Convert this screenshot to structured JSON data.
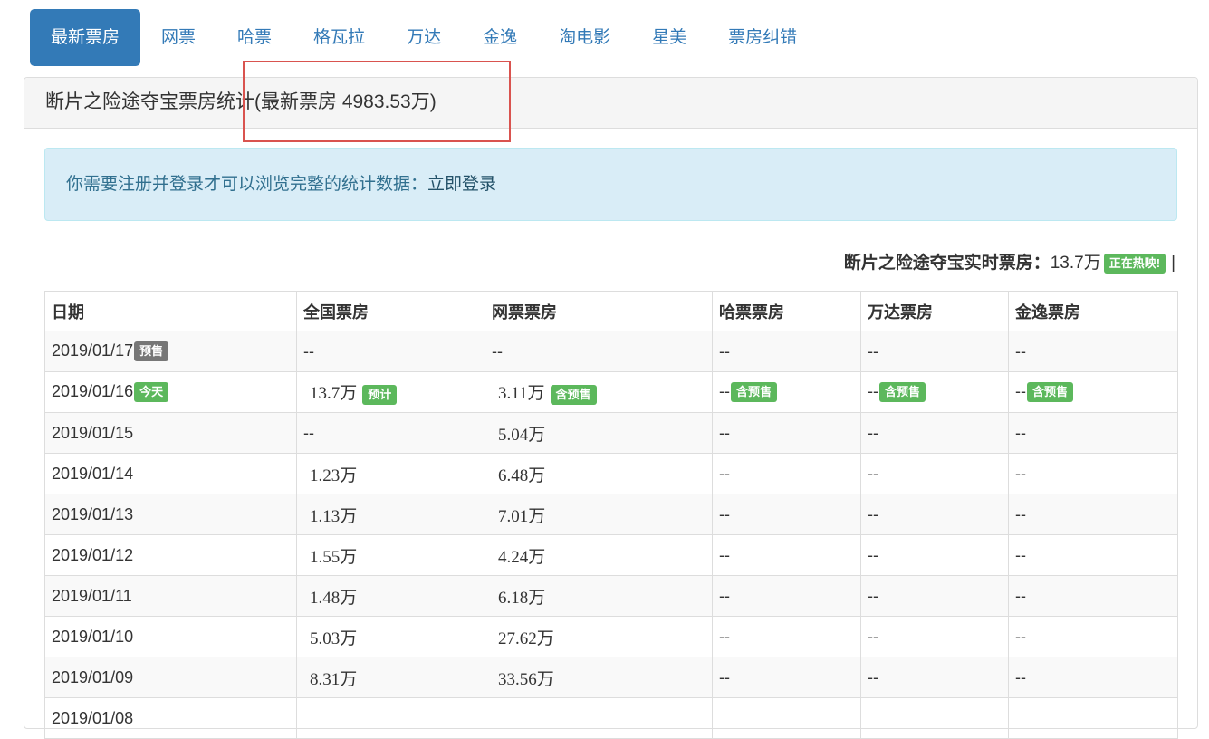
{
  "nav": {
    "tabs": [
      {
        "label": "最新票房",
        "active": true
      },
      {
        "label": "网票",
        "active": false
      },
      {
        "label": "哈票",
        "active": false
      },
      {
        "label": "格瓦拉",
        "active": false
      },
      {
        "label": "万达",
        "active": false
      },
      {
        "label": "金逸",
        "active": false
      },
      {
        "label": "淘电影",
        "active": false
      },
      {
        "label": "星美",
        "active": false
      },
      {
        "label": "票房纠错",
        "active": false
      }
    ]
  },
  "panel": {
    "title": "断片之险途夺宝票房统计(最新票房 4983.53万)"
  },
  "alert": {
    "text": "你需要注册并登录才可以浏览完整的统计数据：",
    "link": "立即登录"
  },
  "live": {
    "label": "断片之险途夺宝实时票房：",
    "value": "13.7万",
    "badge": "正在热映!",
    "separator": "|"
  },
  "table": {
    "headers": [
      "日期",
      "全国票房",
      "网票票房",
      "哈票票房",
      "万达票房",
      "金逸票房"
    ],
    "rows": [
      {
        "date": "2019/01/17",
        "date_badge": "预售",
        "date_badge_color": "#777777",
        "national": "--",
        "national_badge": "",
        "wangpiao": "--",
        "wangpiao_badge": "",
        "hapiao": "--",
        "hapiao_badge": "",
        "wanda": "--",
        "wanda_badge": "",
        "jinyi": "--",
        "jinyi_badge": ""
      },
      {
        "date": "2019/01/16",
        "date_badge": "今天",
        "date_badge_color": "#5cb85c",
        "national": "13.7万",
        "national_badge": "预计",
        "wangpiao": "3.11万",
        "wangpiao_badge": "含预售",
        "hapiao": "--",
        "hapiao_badge": "含预售",
        "wanda": "--",
        "wanda_badge": "含预售",
        "jinyi": "--",
        "jinyi_badge": "含预售"
      },
      {
        "date": "2019/01/15",
        "date_badge": "",
        "national": "--",
        "national_badge": "",
        "wangpiao": "5.04万",
        "wangpiao_badge": "",
        "hapiao": "--",
        "hapiao_badge": "",
        "wanda": "--",
        "wanda_badge": "",
        "jinyi": "--",
        "jinyi_badge": ""
      },
      {
        "date": "2019/01/14",
        "date_badge": "",
        "national": "1.23万",
        "national_badge": "",
        "wangpiao": "6.48万",
        "wangpiao_badge": "",
        "hapiao": "--",
        "hapiao_badge": "",
        "wanda": "--",
        "wanda_badge": "",
        "jinyi": "--",
        "jinyi_badge": ""
      },
      {
        "date": "2019/01/13",
        "date_badge": "",
        "national": "1.13万",
        "national_badge": "",
        "wangpiao": "7.01万",
        "wangpiao_badge": "",
        "hapiao": "--",
        "hapiao_badge": "",
        "wanda": "--",
        "wanda_badge": "",
        "jinyi": "--",
        "jinyi_badge": ""
      },
      {
        "date": "2019/01/12",
        "date_badge": "",
        "national": "1.55万",
        "national_badge": "",
        "wangpiao": "4.24万",
        "wangpiao_badge": "",
        "hapiao": "--",
        "hapiao_badge": "",
        "wanda": "--",
        "wanda_badge": "",
        "jinyi": "--",
        "jinyi_badge": ""
      },
      {
        "date": "2019/01/11",
        "date_badge": "",
        "national": "1.48万",
        "national_badge": "",
        "wangpiao": "6.18万",
        "wangpiao_badge": "",
        "hapiao": "--",
        "hapiao_badge": "",
        "wanda": "--",
        "wanda_badge": "",
        "jinyi": "--",
        "jinyi_badge": ""
      },
      {
        "date": "2019/01/10",
        "date_badge": "",
        "national": "5.03万",
        "national_badge": "",
        "wangpiao": "27.62万",
        "wangpiao_badge": "",
        "hapiao": "--",
        "hapiao_badge": "",
        "wanda": "--",
        "wanda_badge": "",
        "jinyi": "--",
        "jinyi_badge": ""
      },
      {
        "date": "2019/01/09",
        "date_badge": "",
        "national": "8.31万",
        "national_badge": "",
        "wangpiao": "33.56万",
        "wangpiao_badge": "",
        "hapiao": "--",
        "hapiao_badge": "",
        "wanda": "--",
        "wanda_badge": "",
        "jinyi": "--",
        "jinyi_badge": ""
      },
      {
        "date": "2019/01/08",
        "date_badge": "",
        "national": "",
        "national_badge": "",
        "wangpiao": "",
        "wangpiao_badge": "",
        "hapiao": "",
        "hapiao_badge": "",
        "wanda": "",
        "wanda_badge": "",
        "jinyi": "",
        "jinyi_badge": ""
      }
    ]
  },
  "colors": {
    "primary": "#337ab7",
    "success": "#5cb85c",
    "default": "#777777",
    "alert_bg": "#d9edf7",
    "alert_text": "#31708f",
    "highlight_border": "#d9534f"
  }
}
